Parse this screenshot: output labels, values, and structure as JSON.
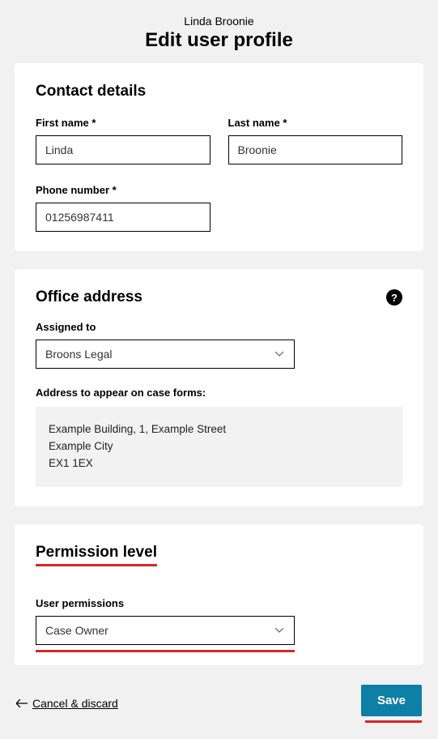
{
  "header": {
    "name": "Linda Broonie",
    "title": "Edit user profile"
  },
  "contact": {
    "title": "Contact details",
    "first_name_label": "First name *",
    "first_name_value": "Linda",
    "last_name_label": "Last name *",
    "last_name_value": "Broonie",
    "phone_label": "Phone number *",
    "phone_value": "01256987411"
  },
  "office": {
    "title": "Office address",
    "help": "?",
    "assigned_label": "Assigned to",
    "assigned_value": "Broons Legal",
    "address_label": "Address to appear on case forms:",
    "address_line1": "Example Building, 1, Example Street",
    "address_line2": "Example City",
    "address_line3": "EX1 1EX"
  },
  "permission": {
    "title": "Permission level",
    "user_permissions_label": "User permissions",
    "user_permissions_value": "Case Owner"
  },
  "footer": {
    "cancel": "Cancel & discard",
    "save": "Save"
  },
  "highlight_color": "#d62828"
}
